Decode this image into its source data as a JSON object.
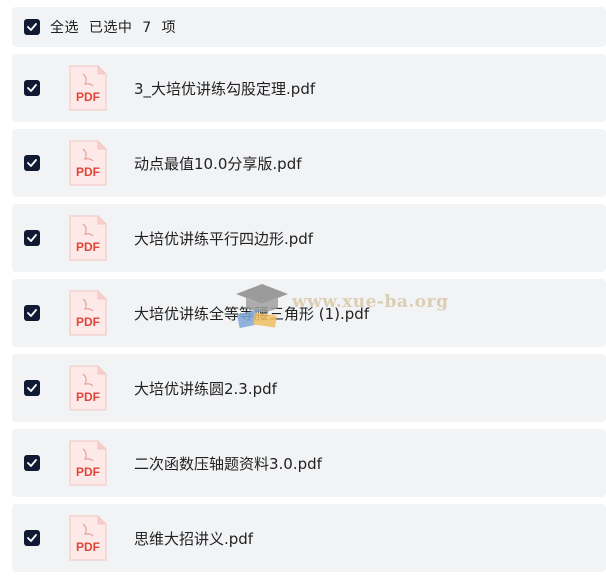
{
  "header": {
    "select_all": "全选  已选中  7  项"
  },
  "icon_label": "PDF",
  "files": [
    {
      "name": "3_大培优讲练勾股定理.pdf",
      "checked": true
    },
    {
      "name": "动点最值10.0分享版.pdf",
      "checked": true
    },
    {
      "name": "大培优讲练平行四边形.pdf",
      "checked": true
    },
    {
      "name": "大培优讲练全等等腰三角形 (1).pdf",
      "checked": true
    },
    {
      "name": "大培优讲练圆2.3.pdf",
      "checked": true
    },
    {
      "name": "二次函数压轴题资料3.0.pdf",
      "checked": true
    },
    {
      "name": "思维大招讲义.pdf",
      "checked": true
    }
  ],
  "watermark": {
    "text": "www.xue-ba.org"
  },
  "colors": {
    "checkbox": "#121a33",
    "row_bg": "#f2f3f5",
    "pdf_red": "#e0453a"
  }
}
